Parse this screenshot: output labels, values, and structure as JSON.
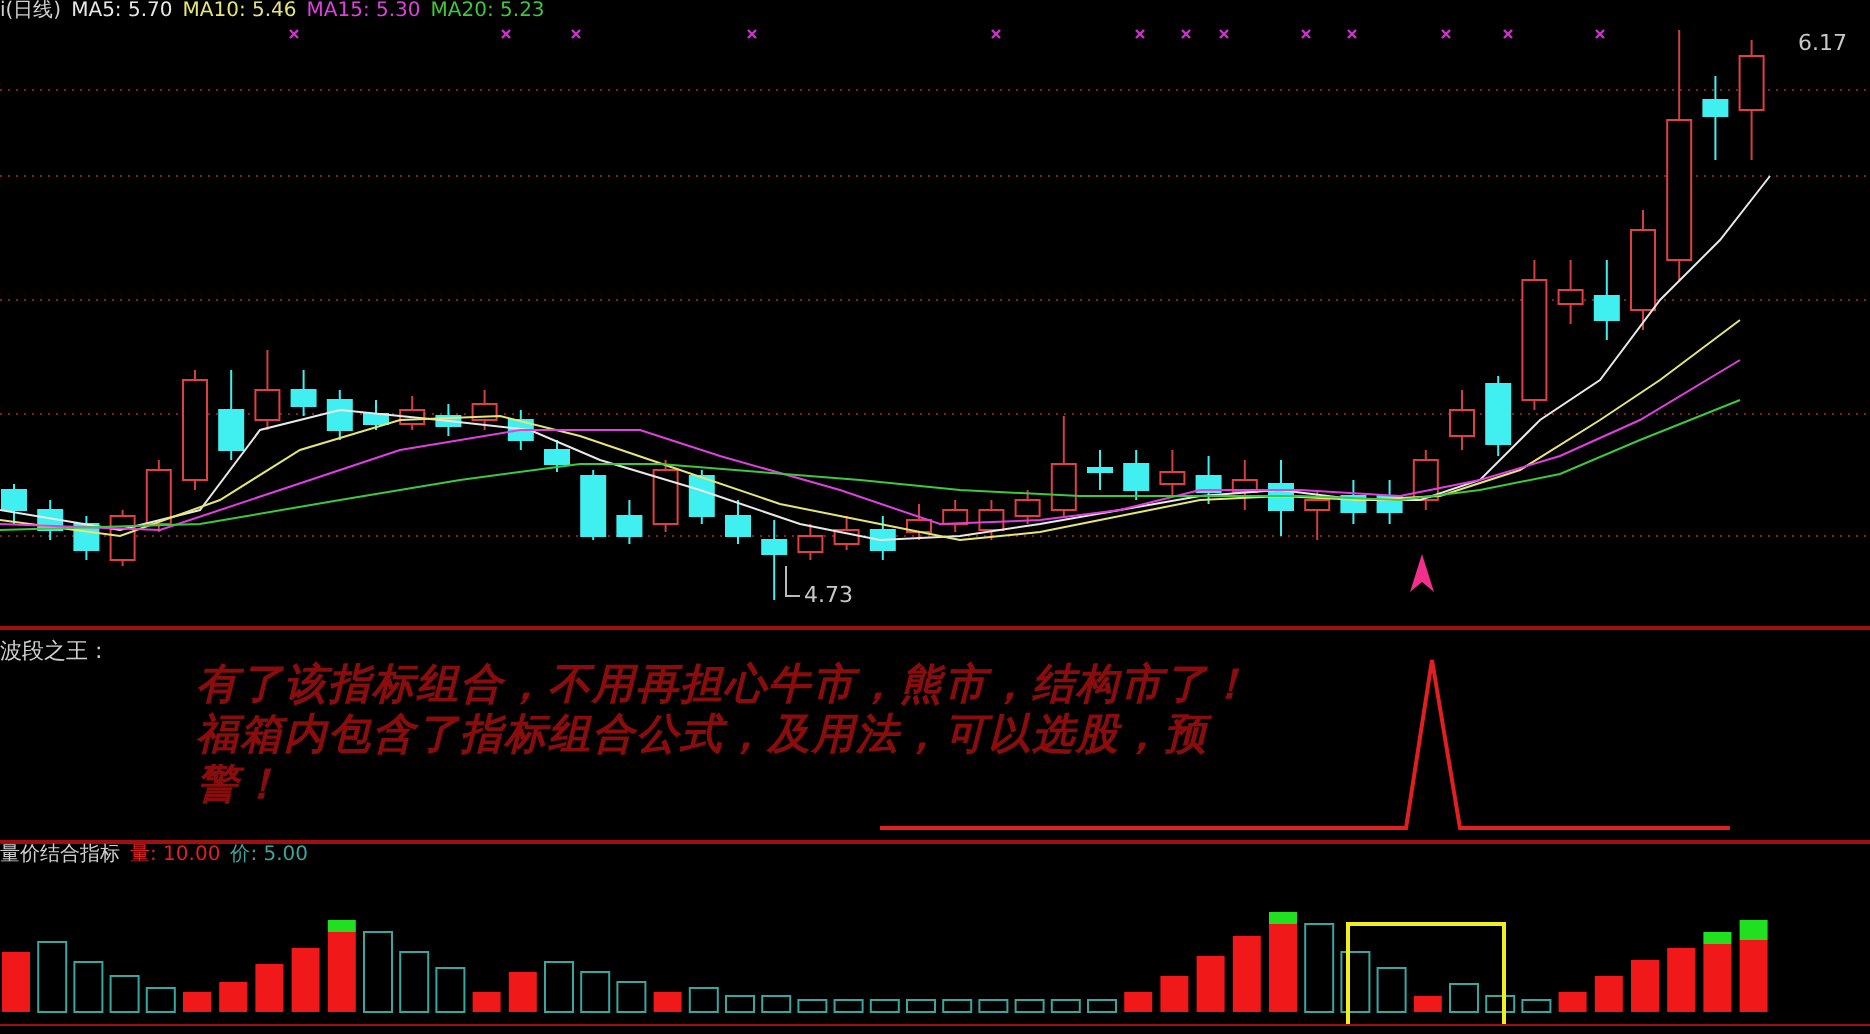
{
  "main_panel": {
    "title": "i(日线)",
    "ma_labels": [
      {
        "label": "MA5: 5.70",
        "color": "#e8e8e8"
      },
      {
        "label": "MA10: 5.46",
        "color": "#e6e676"
      },
      {
        "label": "MA15: 5.30",
        "color": "#e040e0"
      },
      {
        "label": "MA20: 5.23",
        "color": "#3ec83e"
      }
    ],
    "high_label": "6.17",
    "low_label": "4.73"
  },
  "wave_panel": {
    "title": "波段之王 :",
    "message": "有了该指标组合，不用再担心牛市，熊市，结构市了！福箱内包含了指标组合公式，及用法，可以选股，预警！"
  },
  "volume_panel": {
    "title": "量价结合指标",
    "legend": [
      {
        "label": "量: 10.00",
        "color": "#e02020"
      },
      {
        "label": "价: 5.00",
        "color": "#3aa6a0"
      }
    ]
  }
}
